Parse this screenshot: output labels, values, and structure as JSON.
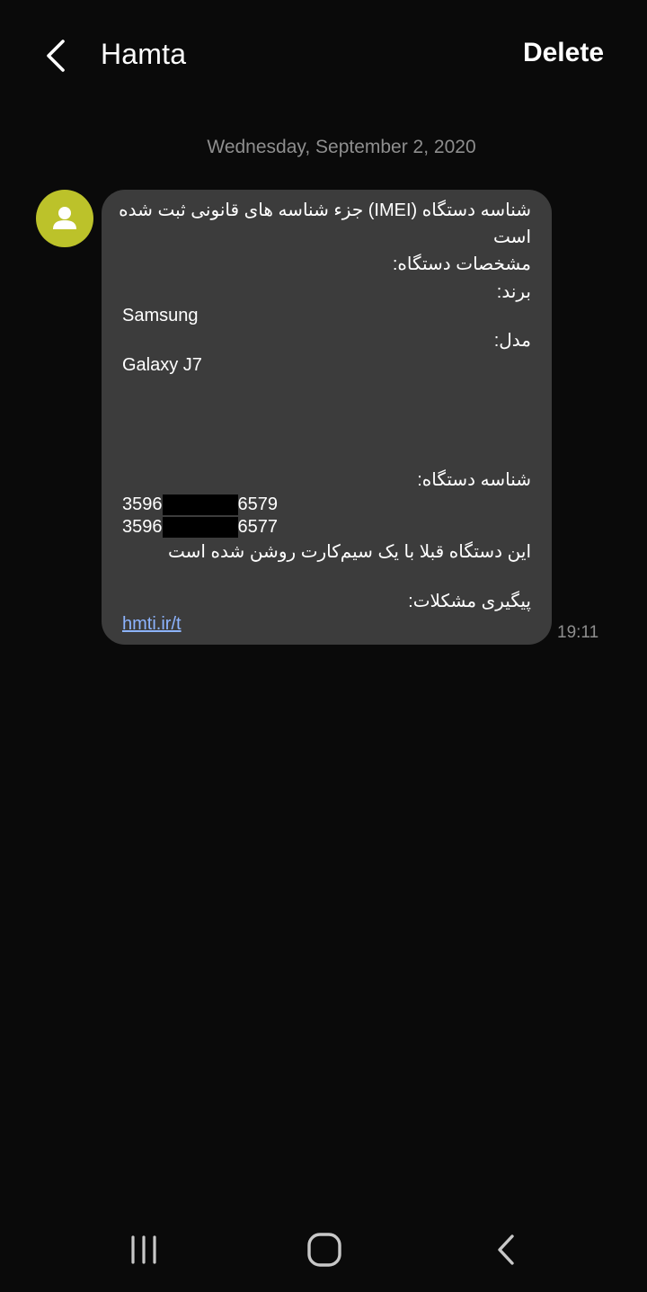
{
  "header": {
    "title": "Hamta",
    "delete_label": "Delete",
    "back_icon": "chevron-left-icon"
  },
  "conversation": {
    "date": "Wednesday, September 2, 2020",
    "avatar_icon": "person-icon",
    "message": {
      "line1": "شناسه دستگاه (IMEI) جزء شناسه های قانونی ثبت شده",
      "line2": "است",
      "line3": "مشخصات دستگاه:",
      "brand_label": "برند:",
      "brand_value": "Samsung",
      "model_label": "مدل:",
      "model_value": "Galaxy J7",
      "device_id_label": "شناسه دستگاه:",
      "imei1_prefix": "3596",
      "imei1_suffix": "6579",
      "imei2_prefix": "3596",
      "imei2_suffix": "6577",
      "status_text": "این دستگاه قبلا با یک سیم‌کارت روشن شده است",
      "support_label": "پیگیری مشکلات:",
      "link_text": "hmti.ir/t"
    },
    "time": "19:11"
  },
  "navbar": {
    "recents_icon": "recent-apps-icon",
    "home_icon": "home-icon",
    "back_icon": "nav-back-icon"
  },
  "colors": {
    "background": "#0a0a0a",
    "bubble": "#3c3c3c",
    "avatar": "#bcc22a",
    "link": "#8db4ff",
    "muted_text": "#8e8e8e"
  }
}
